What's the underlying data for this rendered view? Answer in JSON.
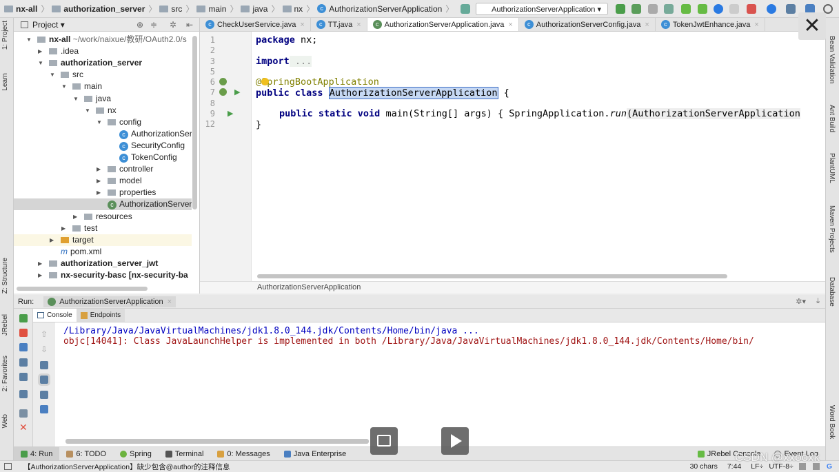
{
  "breadcrumb": [
    "nx-all",
    "authorization_server",
    "src",
    "main",
    "java",
    "nx",
    "AuthorizationServerApplication"
  ],
  "run_config": "AuthorizationServerApplication",
  "left_strip": [
    "1: Project",
    "Learn",
    "Z: Structure",
    "JRebel",
    "2: Favorites",
    "Web"
  ],
  "right_strip": [
    "Bean Validation",
    "Ant Build",
    "PlantUML",
    "Maven Projects",
    "Database",
    "Word Book"
  ],
  "project": {
    "title": "Project",
    "tree": [
      {
        "label": "nx-all",
        "extra": "~/work/naixue/教研/OAuth2.0/s",
        "level": 0,
        "arrow": "down",
        "bold": true,
        "type": "module"
      },
      {
        "label": ".idea",
        "level": 1,
        "arrow": "right",
        "type": "folder"
      },
      {
        "label": "authorization_server",
        "level": 1,
        "arrow": "down",
        "bold": true,
        "type": "module"
      },
      {
        "label": "src",
        "level": 2,
        "arrow": "down",
        "type": "folder"
      },
      {
        "label": "main",
        "level": 3,
        "arrow": "down",
        "type": "folder"
      },
      {
        "label": "java",
        "level": 4,
        "arrow": "down",
        "type": "folder"
      },
      {
        "label": "nx",
        "level": 5,
        "arrow": "down",
        "type": "folder"
      },
      {
        "label": "config",
        "level": 6,
        "arrow": "down",
        "type": "folder"
      },
      {
        "label": "AuthorizationSer",
        "level": 7,
        "type": "class"
      },
      {
        "label": "SecurityConfig",
        "level": 7,
        "type": "class"
      },
      {
        "label": "TokenConfig",
        "level": 7,
        "type": "class"
      },
      {
        "label": "controller",
        "level": 6,
        "arrow": "right",
        "type": "folder"
      },
      {
        "label": "model",
        "level": 6,
        "arrow": "right",
        "type": "folder"
      },
      {
        "label": "properties",
        "level": 6,
        "arrow": "right",
        "type": "folder"
      },
      {
        "label": "AuthorizationServer",
        "level": 6,
        "type": "springclass",
        "selected": true
      },
      {
        "label": "resources",
        "level": 4,
        "arrow": "right",
        "type": "folder"
      },
      {
        "label": "test",
        "level": 3,
        "arrow": "right",
        "type": "folder"
      },
      {
        "label": "target",
        "level": 2,
        "arrow": "right",
        "type": "folder",
        "highlight": true
      },
      {
        "label": "pom.xml",
        "level": 2,
        "type": "maven"
      },
      {
        "label": "authorization_server_jwt",
        "level": 1,
        "arrow": "right",
        "bold": true,
        "type": "module"
      },
      {
        "label": "nx-security-basc [nx-security-ba",
        "level": 1,
        "arrow": "right",
        "bold": true,
        "type": "module"
      }
    ]
  },
  "tabs": [
    {
      "label": "CheckUserService.java"
    },
    {
      "label": "TT.java"
    },
    {
      "label": "AuthorizationServerApplication.java",
      "active": true
    },
    {
      "label": "AuthorizationServerConfig.java"
    },
    {
      "label": "TokenJwtEnhance.java"
    }
  ],
  "code": {
    "line_numbers": [
      "1",
      "2",
      "3",
      "5",
      "6",
      "7",
      "8",
      "9",
      "12"
    ],
    "l1_kw": "package",
    "l1_rest": " nx;",
    "l3_kw": "import",
    "l3_rest": " ...",
    "l6_at": "@",
    "l6_rest": "SpringBootApplication",
    "l7_kw": "public class",
    "l7_cls": "AuthorizationServerApplication",
    "l7_rest": " {",
    "l9_kw": "public static void",
    "l9_rest": " main(String[] args) { SpringApplication.",
    "l9_it": "run",
    "l9_tail": "(AuthorizationServerApplication",
    "l12": "}"
  },
  "editor_breadcrumb": "AuthorizationServerApplication",
  "run": {
    "label": "Run:",
    "config": "AuthorizationServerApplication",
    "tabs": [
      "Console",
      "Endpoints"
    ],
    "lines": [
      "/Library/Java/JavaVirtualMachines/jdk1.8.0_144.jdk/Contents/Home/bin/java ...",
      "objc[14041]: Class JavaLaunchHelper is implemented in both /Library/Java/JavaVirtualMachines/jdk1.8.0_144.jdk/Contents/Home/bin/"
    ]
  },
  "bottom_tools": [
    "4: Run",
    "6: TODO",
    "Spring",
    "Terminal",
    "0: Messages",
    "Java Enterprise"
  ],
  "bottom_right": [
    "JRebel Console",
    "Event Log"
  ],
  "status": {
    "message": "【AuthorizationServerApplication】缺少包含@author的注释信息",
    "chars": "30 chars",
    "pos": "7:44",
    "lf": "LF÷",
    "enc": "UTF-8÷"
  },
  "watermark": "CSDN @xxooxk"
}
